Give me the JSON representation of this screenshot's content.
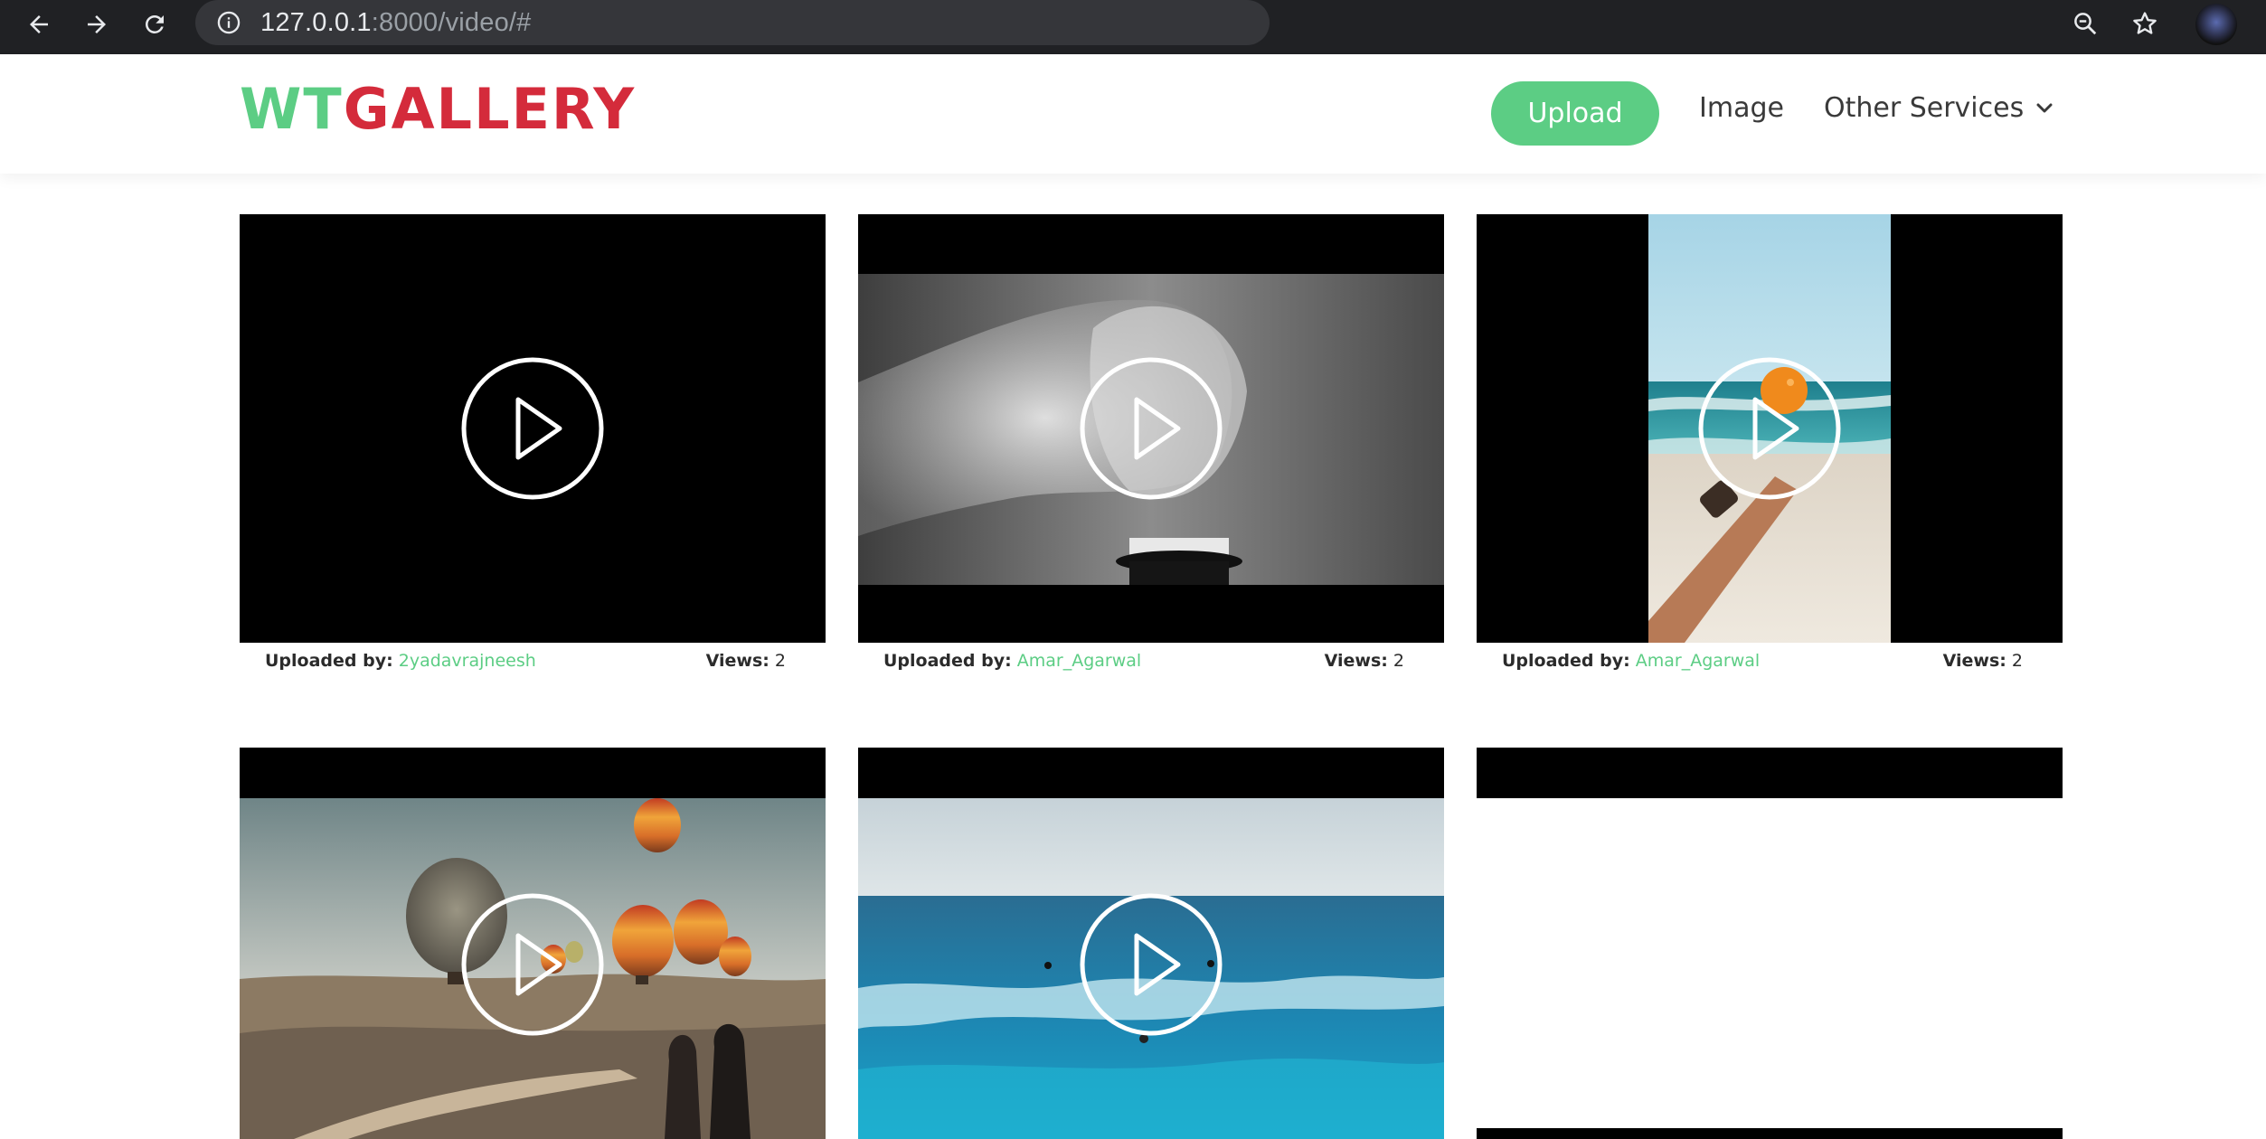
{
  "browser": {
    "url_host": "127.0.0.1",
    "url_rest": ":8000/video/#"
  },
  "site": {
    "logo_part1": "WT",
    "logo_part2": "GALLERY",
    "nav": {
      "upload_label": "Upload",
      "image_label": "Image",
      "other_services_label": "Other Services"
    }
  },
  "videos": [
    {
      "uploaded_by_label": "Uploaded by:",
      "uploader": "2yadavrajneesh",
      "views_label": "Views:",
      "views": "2"
    },
    {
      "uploaded_by_label": "Uploaded by:",
      "uploader": "Amar_Agarwal",
      "views_label": "Views:",
      "views": "2"
    },
    {
      "uploaded_by_label": "Uploaded by:",
      "uploader": "Amar_Agarwal",
      "views_label": "Views:",
      "views": "2"
    }
  ],
  "colors": {
    "brand_green": "#5ccd84",
    "brand_red": "#d42b3b"
  },
  "icons": [
    "back-arrow-icon",
    "forward-arrow-icon",
    "reload-icon",
    "info-icon",
    "zoom-icon",
    "bookmark-star-icon",
    "chevron-down-icon",
    "play-icon"
  ]
}
